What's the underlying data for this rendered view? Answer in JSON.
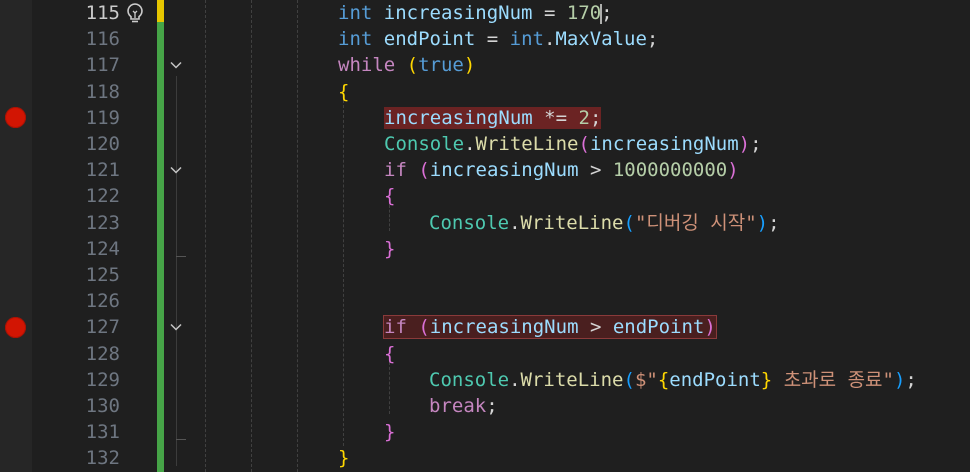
{
  "editor": {
    "colors": {
      "background": "#1f1f1f",
      "breakpoint": "#e51400",
      "change_bar": "#46a447",
      "keyword": "#569cd6",
      "control": "#c586c0",
      "identifier": "#9cdcfe",
      "type": "#4ec9b0",
      "method": "#dcdcaa",
      "number": "#b5cea8",
      "string": "#ce9178"
    },
    "lines": [
      {
        "num": "115",
        "tokens": [
          [
            "kw",
            "int"
          ],
          [
            "plain",
            " "
          ],
          [
            "id",
            "increasingNum"
          ],
          [
            "plain",
            " = "
          ],
          [
            "num",
            "170"
          ],
          [
            "cursor",
            ""
          ],
          [
            "plain",
            ";"
          ]
        ]
      },
      {
        "num": "116",
        "tokens": [
          [
            "kw",
            "int"
          ],
          [
            "plain",
            " "
          ],
          [
            "id",
            "endPoint"
          ],
          [
            "plain",
            " = "
          ],
          [
            "kw",
            "int"
          ],
          [
            "plain",
            "."
          ],
          [
            "id",
            "MaxValue"
          ],
          [
            "plain",
            ";"
          ]
        ]
      },
      {
        "num": "117",
        "tokens": [
          [
            "ctl",
            "while"
          ],
          [
            "plain",
            " "
          ],
          [
            "br1",
            "("
          ],
          [
            "kw",
            "true"
          ],
          [
            "br1",
            ")"
          ]
        ]
      },
      {
        "num": "118",
        "tokens": [
          [
            "br1",
            "{"
          ]
        ]
      },
      {
        "num": "119",
        "tokens": [
          [
            "id",
            "increasingNum"
          ],
          [
            "plain",
            " *= "
          ],
          [
            "num",
            "2"
          ],
          [
            "plain",
            ";"
          ]
        ]
      },
      {
        "num": "120",
        "tokens": [
          [
            "type",
            "Console"
          ],
          [
            "plain",
            "."
          ],
          [
            "fn",
            "WriteLine"
          ],
          [
            "br2",
            "("
          ],
          [
            "id",
            "increasingNum"
          ],
          [
            "br2",
            ")"
          ],
          [
            "plain",
            ";"
          ]
        ]
      },
      {
        "num": "121",
        "tokens": [
          [
            "ctl",
            "if"
          ],
          [
            "plain",
            " "
          ],
          [
            "br2",
            "("
          ],
          [
            "id",
            "increasingNum"
          ],
          [
            "plain",
            " > "
          ],
          [
            "num",
            "1000000000"
          ],
          [
            "br2",
            ")"
          ]
        ]
      },
      {
        "num": "122",
        "tokens": [
          [
            "br2",
            "{"
          ]
        ]
      },
      {
        "num": "123",
        "tokens": [
          [
            "type",
            "Console"
          ],
          [
            "plain",
            "."
          ],
          [
            "fn",
            "WriteLine"
          ],
          [
            "br3",
            "("
          ],
          [
            "str",
            "\"디버깅 시작\""
          ],
          [
            "br3",
            ")"
          ],
          [
            "plain",
            ";"
          ]
        ]
      },
      {
        "num": "124",
        "tokens": [
          [
            "br2",
            "}"
          ]
        ]
      },
      {
        "num": "125",
        "tokens": []
      },
      {
        "num": "126",
        "tokens": []
      },
      {
        "num": "127",
        "tokens": [
          [
            "ctl",
            "if"
          ],
          [
            "plain",
            " "
          ],
          [
            "br2",
            "("
          ],
          [
            "id",
            "increasingNum"
          ],
          [
            "plain",
            " > "
          ],
          [
            "id",
            "endPoint"
          ],
          [
            "br2",
            ")"
          ]
        ]
      },
      {
        "num": "128",
        "tokens": [
          [
            "br2",
            "{"
          ]
        ]
      },
      {
        "num": "129",
        "tokens": [
          [
            "type",
            "Console"
          ],
          [
            "plain",
            "."
          ],
          [
            "fn",
            "WriteLine"
          ],
          [
            "br3",
            "("
          ],
          [
            "str",
            "$\""
          ],
          [
            "br1",
            "{"
          ],
          [
            "id",
            "endPoint"
          ],
          [
            "br1",
            "}"
          ],
          [
            "str",
            " 초과로 종료\""
          ],
          [
            "br3",
            ")"
          ],
          [
            "plain",
            ";"
          ]
        ]
      },
      {
        "num": "130",
        "tokens": [
          [
            "ctl",
            "break"
          ],
          [
            "plain",
            ";"
          ]
        ]
      },
      {
        "num": "131",
        "tokens": [
          [
            "br2",
            "}"
          ]
        ]
      },
      {
        "num": "132",
        "tokens": [
          [
            "br1",
            "}"
          ]
        ]
      }
    ]
  }
}
